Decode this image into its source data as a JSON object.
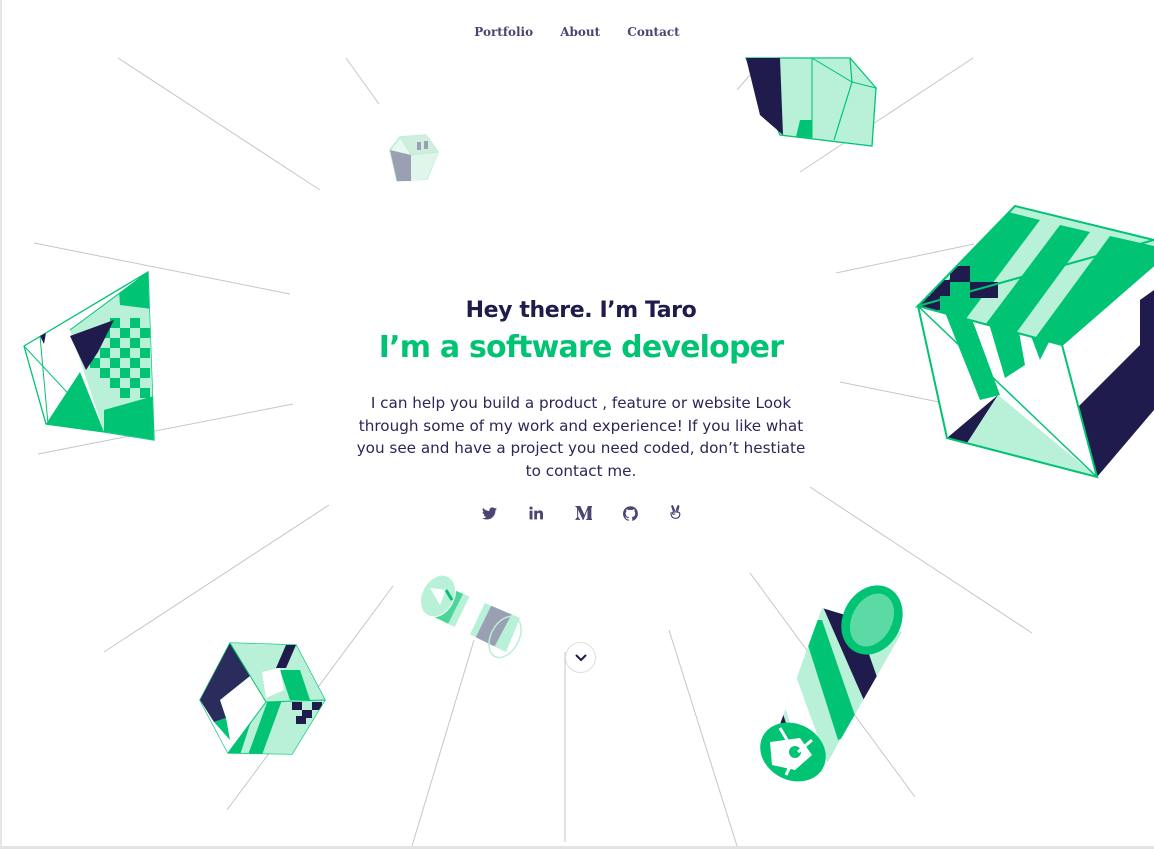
{
  "nav": {
    "items": [
      {
        "label": "Portfolio"
      },
      {
        "label": "About"
      },
      {
        "label": "Contact"
      }
    ]
  },
  "hero": {
    "greeting": "Hey there. I’m Taro",
    "headline": "I’m a software developer",
    "description": "I can help you build a product , feature or website Look through some of my work and experience! If you like what you see and have a project you need coded, don’t hestiate to contact me."
  },
  "socials": [
    {
      "icon": "twitter-icon"
    },
    {
      "icon": "linkedin-icon"
    },
    {
      "icon": "medium-icon"
    },
    {
      "icon": "github-icon"
    },
    {
      "icon": "angellist-icon"
    }
  ],
  "scroll": {
    "icon": "chevron-down-icon"
  },
  "colors": {
    "navy": "#1f1b4d",
    "green": "#00c473",
    "mint": "#b8f0d8",
    "slate": "#9aa0b2",
    "line": "#c6c6c6"
  }
}
